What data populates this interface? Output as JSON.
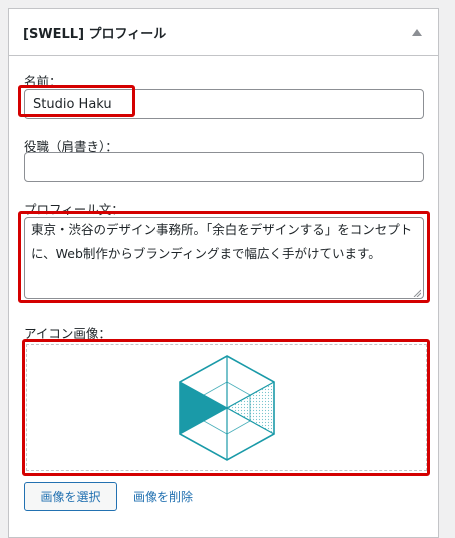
{
  "widget": {
    "title": "[SWELL] プロフィール",
    "toggle_icon": "arrow-up-icon"
  },
  "fields": {
    "name": {
      "label": "名前：",
      "value": "Studio Haku",
      "placeholder": ""
    },
    "role": {
      "label": "役職（肩書き）：",
      "value": "",
      "placeholder": ""
    },
    "profile_text": {
      "label": "プロフィール文：",
      "value": "東京・渋谷のデザイン事務所。「余白をデザインする」をコンセプトに、Web制作からブランディングまで幅広く手がけています。"
    },
    "icon_image": {
      "label": "アイコン画像：",
      "image_icon": "hexagon-logo-icon"
    }
  },
  "buttons": {
    "select_image": "画像を選択",
    "delete_image": "画像を削除"
  },
  "colors": {
    "highlight": "#d40000",
    "accent": "#2271b1",
    "logo": "#1a9aa8"
  }
}
